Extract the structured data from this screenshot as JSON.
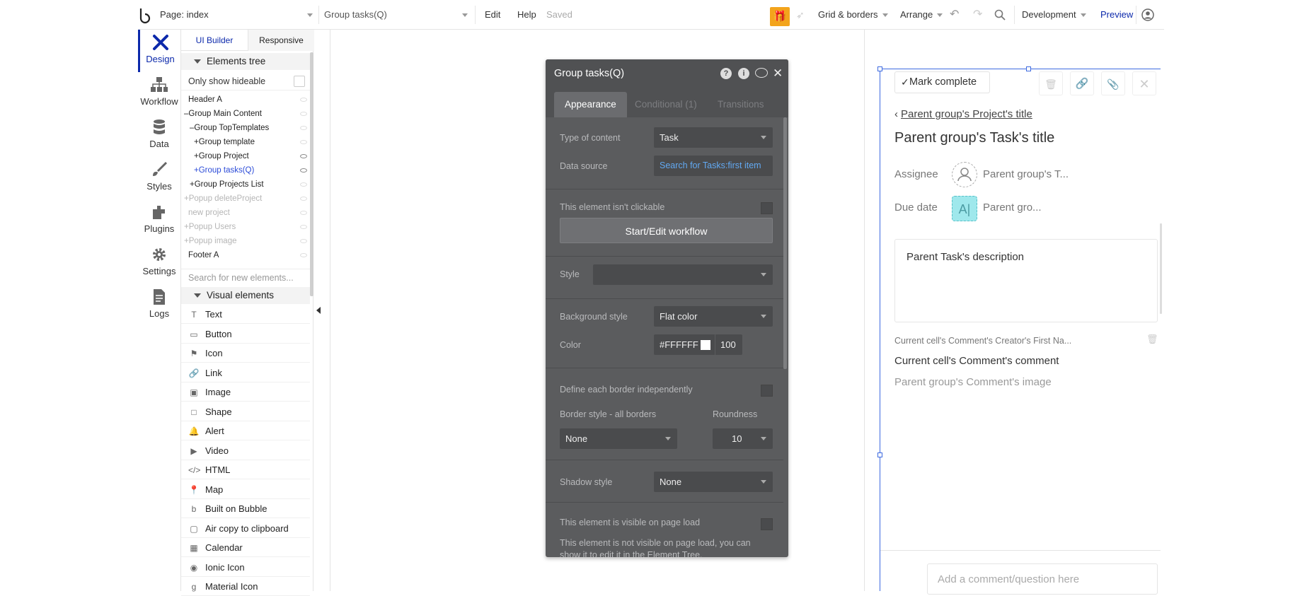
{
  "topbar": {
    "page_label": "Page: index",
    "element_select": "Group tasks(Q)",
    "menu_edit": "Edit",
    "menu_help": "Help",
    "status": "Saved",
    "grid": "Grid & borders",
    "arrange": "Arrange",
    "env": "Development",
    "preview": "Preview"
  },
  "rail": {
    "design": "Design",
    "workflow": "Workflow",
    "data": "Data",
    "styles": "Styles",
    "plugins": "Plugins",
    "settings": "Settings",
    "logs": "Logs"
  },
  "leftpanel": {
    "tab_ui": "UI Builder",
    "tab_responsive": "Responsive",
    "tree_title": "Elements tree",
    "only_hideable": "Only show hideable",
    "tree": [
      {
        "label": "Header A",
        "prefix": "",
        "state": "normal"
      },
      {
        "label": "Group Main Content",
        "prefix": "–",
        "state": "normal"
      },
      {
        "label": "Group TopTemplates",
        "prefix": "–",
        "state": "normal"
      },
      {
        "label": "Group template",
        "prefix": "+",
        "state": "normal"
      },
      {
        "label": "Group Project",
        "prefix": "+",
        "state": "normal"
      },
      {
        "label": "Group tasks(Q)",
        "prefix": "+",
        "state": "selected"
      },
      {
        "label": "Group Projects List",
        "prefix": "+",
        "state": "normal"
      },
      {
        "label": "Popup deleteProject",
        "prefix": "+",
        "state": "dim"
      },
      {
        "label": "new project",
        "prefix": "",
        "state": "dim"
      },
      {
        "label": "Popup Users",
        "prefix": "+",
        "state": "dim"
      },
      {
        "label": "Popup image",
        "prefix": "+",
        "state": "dim"
      },
      {
        "label": "Footer A",
        "prefix": "",
        "state": "normal"
      }
    ],
    "search_placeholder": "Search for new elements...",
    "visual_title": "Visual elements",
    "visual": [
      {
        "label": "Text",
        "icon": "T"
      },
      {
        "label": "Button",
        "icon": "▭"
      },
      {
        "label": "Icon",
        "icon": "⚑"
      },
      {
        "label": "Link",
        "icon": "🔗"
      },
      {
        "label": "Image",
        "icon": "▣"
      },
      {
        "label": "Shape",
        "icon": "□"
      },
      {
        "label": "Alert",
        "icon": "🔔"
      },
      {
        "label": "Video",
        "icon": "▶"
      },
      {
        "label": "HTML",
        "icon": "</>"
      },
      {
        "label": "Map",
        "icon": "📍"
      },
      {
        "label": "Built on Bubble",
        "icon": "b"
      },
      {
        "label": "Air copy to clipboard",
        "icon": "▢"
      },
      {
        "label": "Calendar",
        "icon": "▦"
      },
      {
        "label": "Ionic Icon",
        "icon": "◉"
      },
      {
        "label": "Material Icon",
        "icon": "g"
      }
    ]
  },
  "editor": {
    "title": "Group tasks(Q)",
    "tab_appearance": "Appearance",
    "tab_conditional": "Conditional (1)",
    "tab_transitions": "Transitions",
    "type_label": "Type of content",
    "type_value": "Task",
    "source_label": "Data source",
    "source_value": "Search for Tasks:first item",
    "clickable_label": "This element isn't clickable",
    "workflow_btn": "Start/Edit workflow",
    "style_label": "Style",
    "style_value": "",
    "bg_label": "Background style",
    "bg_value": "Flat color",
    "color_label": "Color",
    "color_hex": "#FFFFFF",
    "color_opacity": "100",
    "border_indep_label": "Define each border independently",
    "border_style_label": "Border style - all borders",
    "roundness_label": "Roundness",
    "border_value": "None",
    "roundness_value": "10",
    "shadow_label": "Shadow style",
    "shadow_value": "None",
    "visible_label": "This element is visible on page load",
    "not_visible_note_1": "This element is not visible on page load, you can",
    "not_visible_note_2": "show it to edit it in the Element Tree."
  },
  "rightpanel": {
    "mark_complete": "Mark complete",
    "back_link": "Parent group's Project's title",
    "task_title": "Parent group's Task's title",
    "assignee_label": "Assignee",
    "assignee_value": "Parent group's T...",
    "due_label": "Due date",
    "due_value": "Parent gro...",
    "description": "Parent Task's description",
    "comment_author": "Current cell's Comment's Creator's First Na...",
    "comment_text": "Current cell's Comment's comment",
    "comment_image": "Parent group's Comment's image",
    "comment_placeholder": "Add a comment/question here"
  },
  "colors": {
    "accent": "#0c29ab",
    "link": "#2b4bd8",
    "gift": "#f3a41c",
    "editor_bg": "#5b5c5e"
  }
}
